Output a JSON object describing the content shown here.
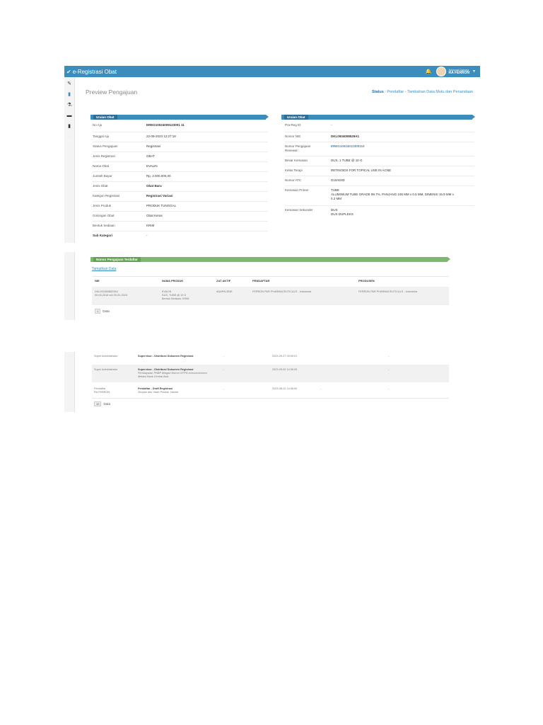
{
  "app": {
    "title": "e-Registrasi Obat",
    "user_greeting": "Selamat Datang",
    "user_name": "RA FERRON"
  },
  "page": {
    "heading": "Preview Pengajuan",
    "breadcrumb_status": "Status",
    "breadcrumb_path": " : Pendaftar - Tambahan Data Mutu dan Penandaan"
  },
  "uraian_left": {
    "title": "Uraian Obat",
    "rows": [
      {
        "label": "No Aju",
        "value": "EREG10024009123001 11"
      },
      {
        "label": "Tanggal Aju",
        "value": "22-09-2023 12:27:18"
      },
      {
        "label": "Status Pengajuan",
        "value": "Registrasi"
      },
      {
        "label": "Jenis Registrasi",
        "value": "OBAT"
      },
      {
        "label": "Nama Obat",
        "value": "EVALIN"
      },
      {
        "label": "Jumlah Bayar",
        "value": "Rp. 2.000.000,00"
      },
      {
        "label": "Jenis Obat",
        "value": "Obat Baru"
      },
      {
        "label": "Kategori Registrasi",
        "value": "Registrasi Variasi"
      },
      {
        "label": "Jenis Produk",
        "value": "PRODUK TUNGGAL"
      },
      {
        "label": "Golongan Obat",
        "value": "Obat Keras"
      },
      {
        "label": "Bentuk Sediaan",
        "value": "KRIM"
      },
      {
        "label": "Sub Kategori",
        "value": "-"
      }
    ]
  },
  "uraian_right": {
    "title": "Uraian Obat",
    "rows": [
      {
        "label": "Pra-Reg ID",
        "value": "-"
      },
      {
        "label": "Nomor NIE",
        "value": "DKL0934008529A1"
      },
      {
        "label": "Nomor Pengajuan Renewal :",
        "value": "EREG10024012300110"
      },
      {
        "label": "Besar Kemasan",
        "value": "DUS, 1 TUBE @ 10 G"
      },
      {
        "label": "Kelas Terapi",
        "value": "RETINOIDS FOR TOPICAL USE IN ACNE"
      },
      {
        "label": "Nomor ATC",
        "value": "D10AD03"
      },
      {
        "label": "Kemasan Primer",
        "value": "TUBE"
      },
      {
        "label": "",
        "value": "ALUMINIUM TUBE GRADE 99.7%, PANJANG 105 MM x 0.5 MM, DIMENSI 15.9 MM x 0.2 MM"
      },
      {
        "label": "Kemasan Sekunder",
        "value": "DUS"
      },
      {
        "label": "",
        "value": "DUS DUPLEKS"
      }
    ]
  },
  "nomor_section": {
    "title": "Nomor Pengajuan Terdaftar",
    "show_link": "Tampilkan Data",
    "headers": [
      "NIE",
      "NAMA PRODUK",
      "ZAT AKTIF",
      "PENDAFTAR",
      "PRODUSEN"
    ],
    "row": {
      "nie": "DKL0934008529A1",
      "nie_date": "00-00-2018 s/d 00-00-2023",
      "produk": "EVALIN",
      "produk_pack": "DUS, TUBE @ 10 G",
      "produk_form": "Bentuk Sediaan: KRIM",
      "zat": "ADAPALENE",
      "pendaftar": "FERRON PAR PHARMACEUTICALS - Indonesia",
      "produsen": "FERRON PAR PHARMACEUTICALS - Indonesia"
    },
    "pager_num": "1",
    "pager_text": "Data"
  },
  "history": {
    "rows": [
      {
        "role": "Super Administrator",
        "role2": "",
        "title": "Supervisor - Distribusi Dokumen Registrasi",
        "note": "",
        "dash1": "-",
        "time": "2023-09-27 09:00:01",
        "dash2": "-"
      },
      {
        "role": "Super Administrator",
        "role2": "",
        "title": "Supervisor - Distribusi Dokumen Registrasi",
        "note": "Pembayaran PNBP dengan Nomor NTPN xxxxxxxxxxxxxx Melalui Bank Central Asia",
        "dash1": "-",
        "time": "2023-09-02 14:36:09",
        "dash2": "-"
      },
      {
        "role": "Pendaftar",
        "role2": "RA FERRON",
        "title": "Pendaftar - Draft Registrasi",
        "note": "Simpan dan Ubah Produk: Variasi",
        "dash1": "-",
        "time": "2023-08-22 14:36:00",
        "dash2": "-"
      }
    ],
    "pager_num": "10",
    "pager_text": "Data"
  }
}
